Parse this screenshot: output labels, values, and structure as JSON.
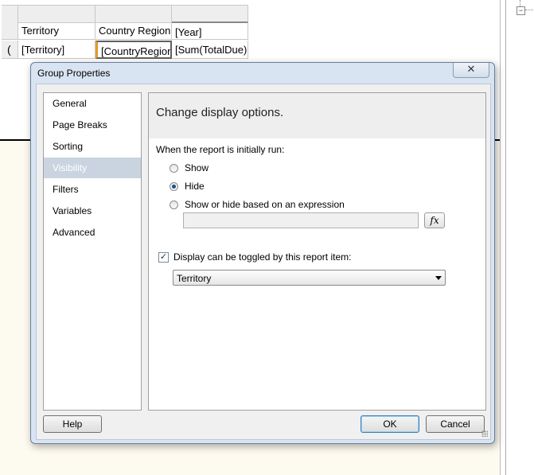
{
  "report": {
    "header_row": [
      "Territory",
      "Country Region",
      "[Year]"
    ],
    "detail_row": [
      "[Territory]",
      "[CountryRegionN",
      "[Sum(TotalDue)"
    ]
  },
  "dialog": {
    "title": "Group Properties",
    "close_glyph": "✕",
    "nav_items": [
      "General",
      "Page Breaks",
      "Sorting",
      "Visibility",
      "Filters",
      "Variables",
      "Advanced"
    ],
    "selected_nav": "Visibility",
    "header": "Change display options.",
    "initial_run_label": "When the report is initially run:",
    "options": [
      {
        "label": "Show",
        "checked": false
      },
      {
        "label": "Hide",
        "checked": true
      },
      {
        "label": "Show or hide based on an expression",
        "checked": false
      }
    ],
    "expression_value": "",
    "fx_label": "fx",
    "toggle_label": "Display can be toggled by this report item:",
    "toggle_checked": true,
    "toggle_item": "Territory",
    "help_button": "Help",
    "ok_button": "OK",
    "cancel_button": "Cancel"
  },
  "colors": {
    "selected_nav_bg": "#c9d4e0",
    "dialog_frame": "#d8e4f2",
    "radio_dot": "#1b4f8e"
  }
}
